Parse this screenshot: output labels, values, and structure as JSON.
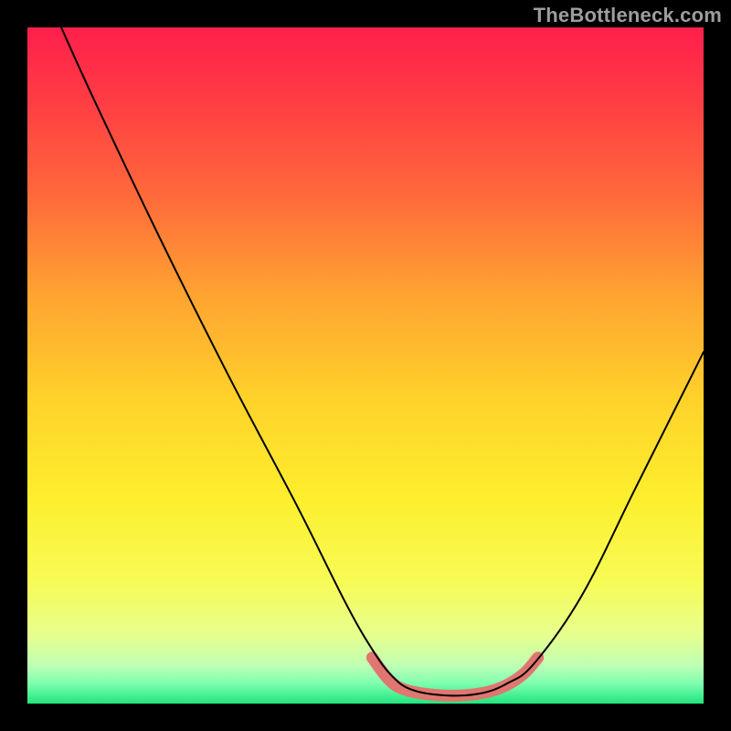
{
  "watermark": "TheBottleneck.com",
  "chart_data": {
    "type": "line",
    "title": "",
    "xlabel": "",
    "ylabel": "",
    "xlim": [
      0,
      100
    ],
    "ylim": [
      0,
      100
    ],
    "gradient_stops": [
      {
        "offset": 0.0,
        "color": "#ff1f4b"
      },
      {
        "offset": 0.1,
        "color": "#ff3a45"
      },
      {
        "offset": 0.25,
        "color": "#ff6a3a"
      },
      {
        "offset": 0.4,
        "color": "#ffa531"
      },
      {
        "offset": 0.55,
        "color": "#ffd22a"
      },
      {
        "offset": 0.7,
        "color": "#fdef2e"
      },
      {
        "offset": 0.82,
        "color": "#f7fb56"
      },
      {
        "offset": 0.9,
        "color": "#e6ff8f"
      },
      {
        "offset": 0.945,
        "color": "#bcffb4"
      },
      {
        "offset": 0.97,
        "color": "#7effb0"
      },
      {
        "offset": 1.0,
        "color": "#22e57e"
      }
    ],
    "series": [
      {
        "name": "bottleneck-curve",
        "stroke": "#000000",
        "stroke_width": 2,
        "points": [
          {
            "x": 5.0,
            "y": 100.0
          },
          {
            "x": 10.0,
            "y": 89.0
          },
          {
            "x": 20.0,
            "y": 68.0
          },
          {
            "x": 30.0,
            "y": 48.0
          },
          {
            "x": 40.0,
            "y": 29.0
          },
          {
            "x": 47.0,
            "y": 15.0
          },
          {
            "x": 51.0,
            "y": 8.0
          },
          {
            "x": 54.0,
            "y": 4.0
          },
          {
            "x": 57.0,
            "y": 2.0
          },
          {
            "x": 62.0,
            "y": 1.2
          },
          {
            "x": 67.0,
            "y": 1.5
          },
          {
            "x": 71.0,
            "y": 3.0
          },
          {
            "x": 75.0,
            "y": 6.0
          },
          {
            "x": 82.0,
            "y": 16.0
          },
          {
            "x": 90.0,
            "y": 32.0
          },
          {
            "x": 100.0,
            "y": 52.0
          }
        ]
      },
      {
        "name": "optimal-band",
        "stroke": "#e0766f",
        "stroke_width": 13,
        "linecap": "round",
        "points": [
          {
            "x": 51.0,
            "y": 6.8
          },
          {
            "x": 53.5,
            "y": 3.5
          },
          {
            "x": 56.0,
            "y": 2.0
          },
          {
            "x": 60.0,
            "y": 1.3
          },
          {
            "x": 64.0,
            "y": 1.2
          },
          {
            "x": 68.0,
            "y": 1.7
          },
          {
            "x": 71.0,
            "y": 2.8
          },
          {
            "x": 73.5,
            "y": 4.5
          },
          {
            "x": 75.5,
            "y": 6.8
          }
        ]
      }
    ]
  }
}
